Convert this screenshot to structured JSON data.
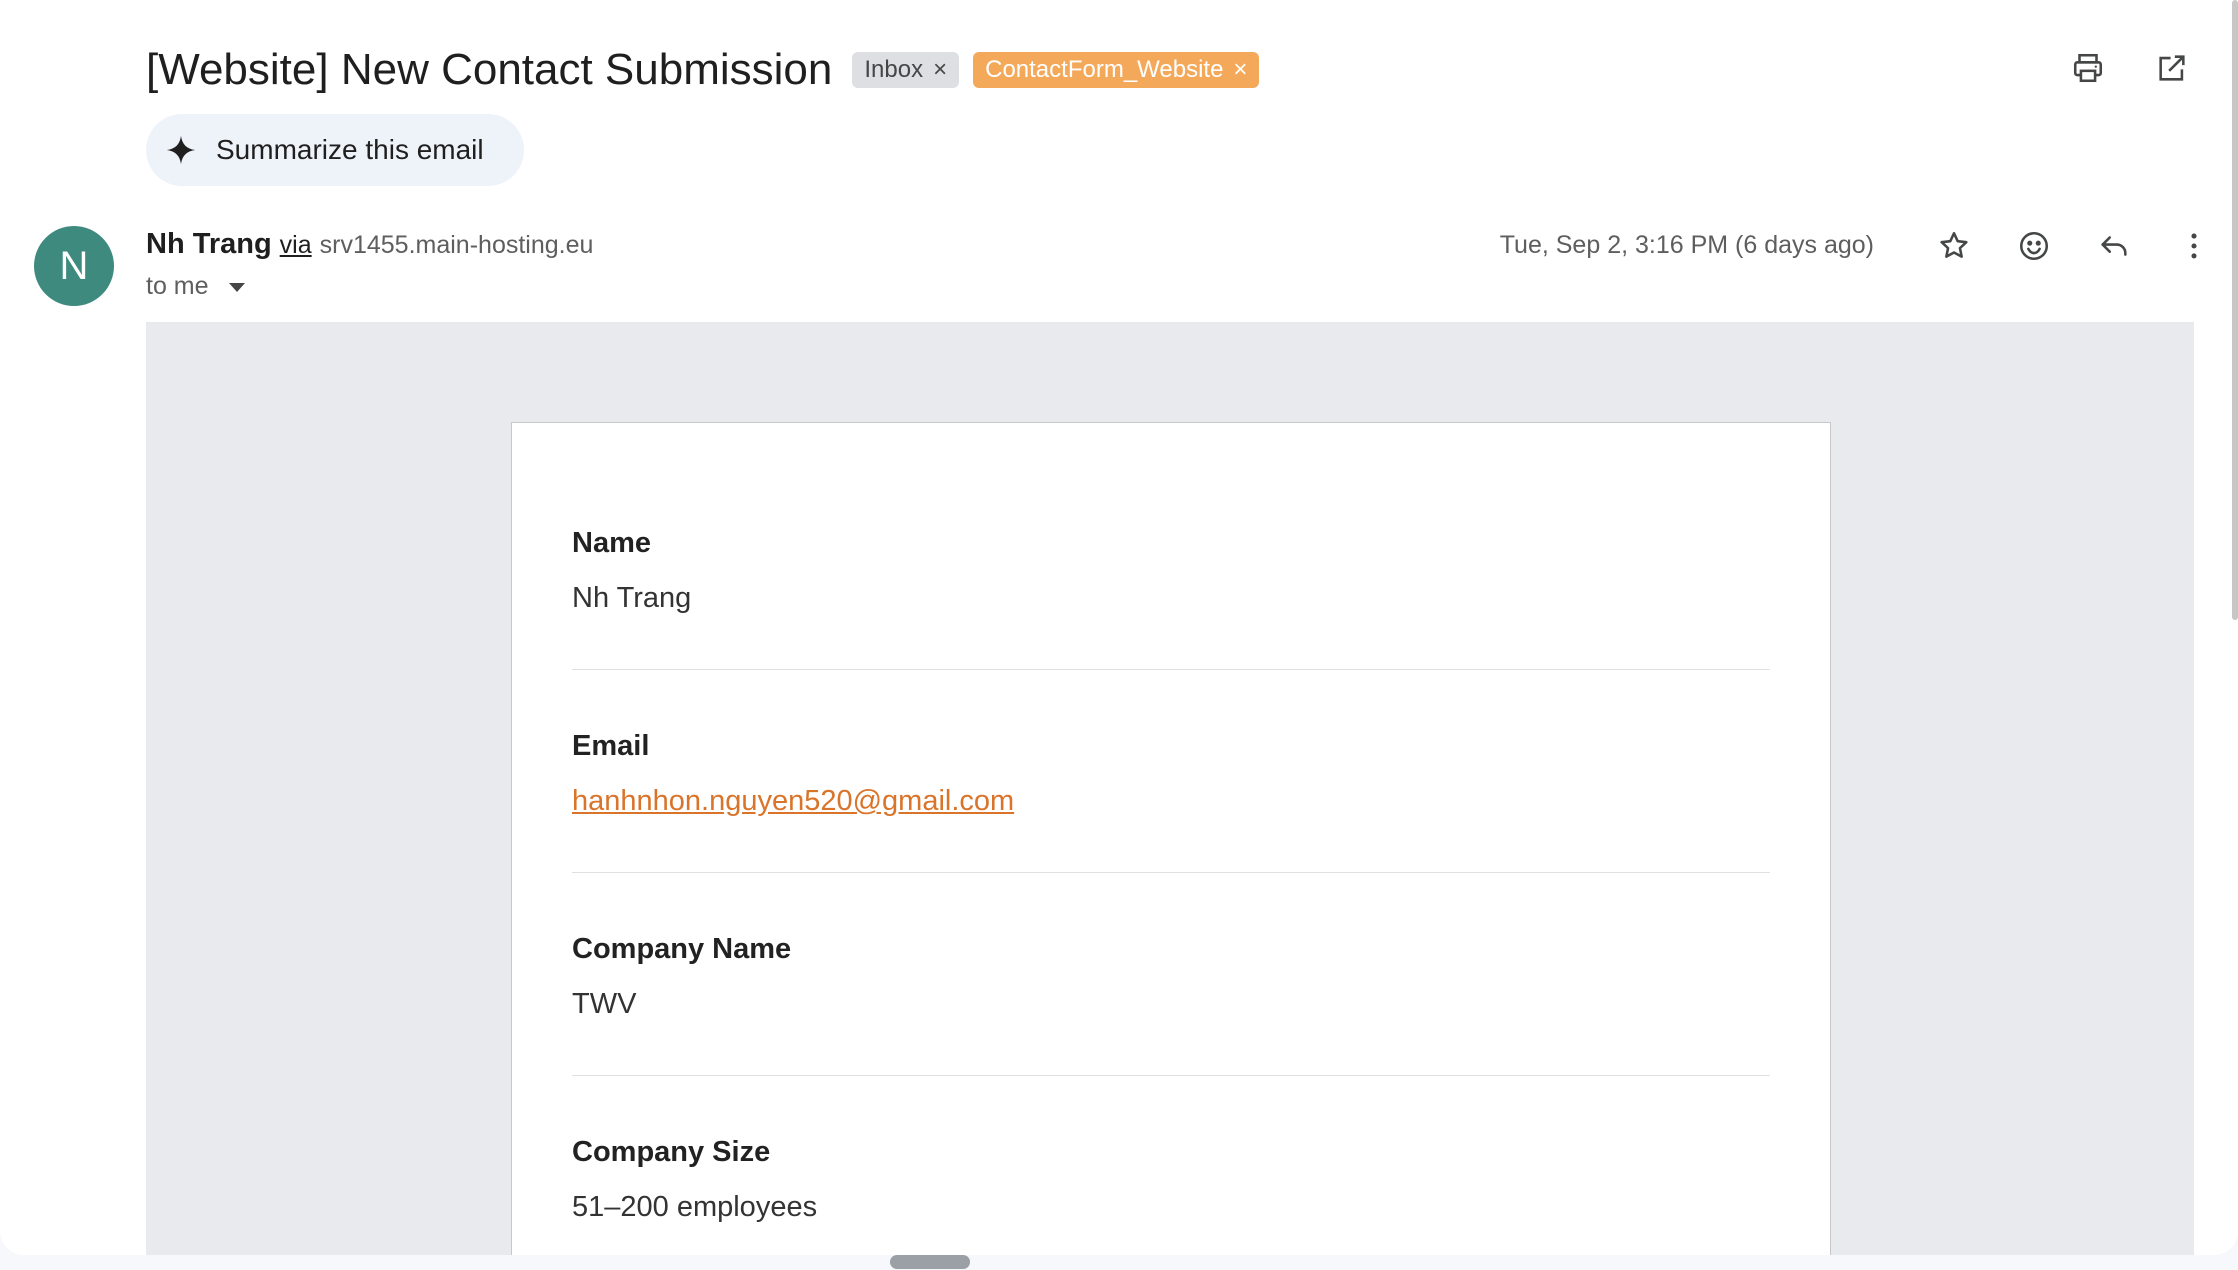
{
  "email": {
    "subject": "[Website] New Contact Submission",
    "labels": [
      {
        "text": "Inbox",
        "remove": "×"
      },
      {
        "text": "ContactForm_Website",
        "remove": "×"
      }
    ],
    "summarize_label": "Summarize this email",
    "sender": {
      "initial": "N",
      "name": "Nh Trang",
      "via": "via",
      "host": "srv1455.main-hosting.eu",
      "to": "to me"
    },
    "date": "Tue, Sep 2, 3:16 PM (6 days ago)"
  },
  "form": {
    "fields": [
      {
        "label": "Name",
        "value": "Nh Trang"
      },
      {
        "label": "Email",
        "value": "hanhnhon.nguyen520@gmail.com"
      },
      {
        "label": "Company Name",
        "value": "TWV"
      },
      {
        "label": "Company Size",
        "value": "51–200 employees"
      }
    ]
  },
  "colors": {
    "avatar": "#3e8a7e",
    "contact_label": "#f4a95a",
    "link": "#d9742a"
  }
}
